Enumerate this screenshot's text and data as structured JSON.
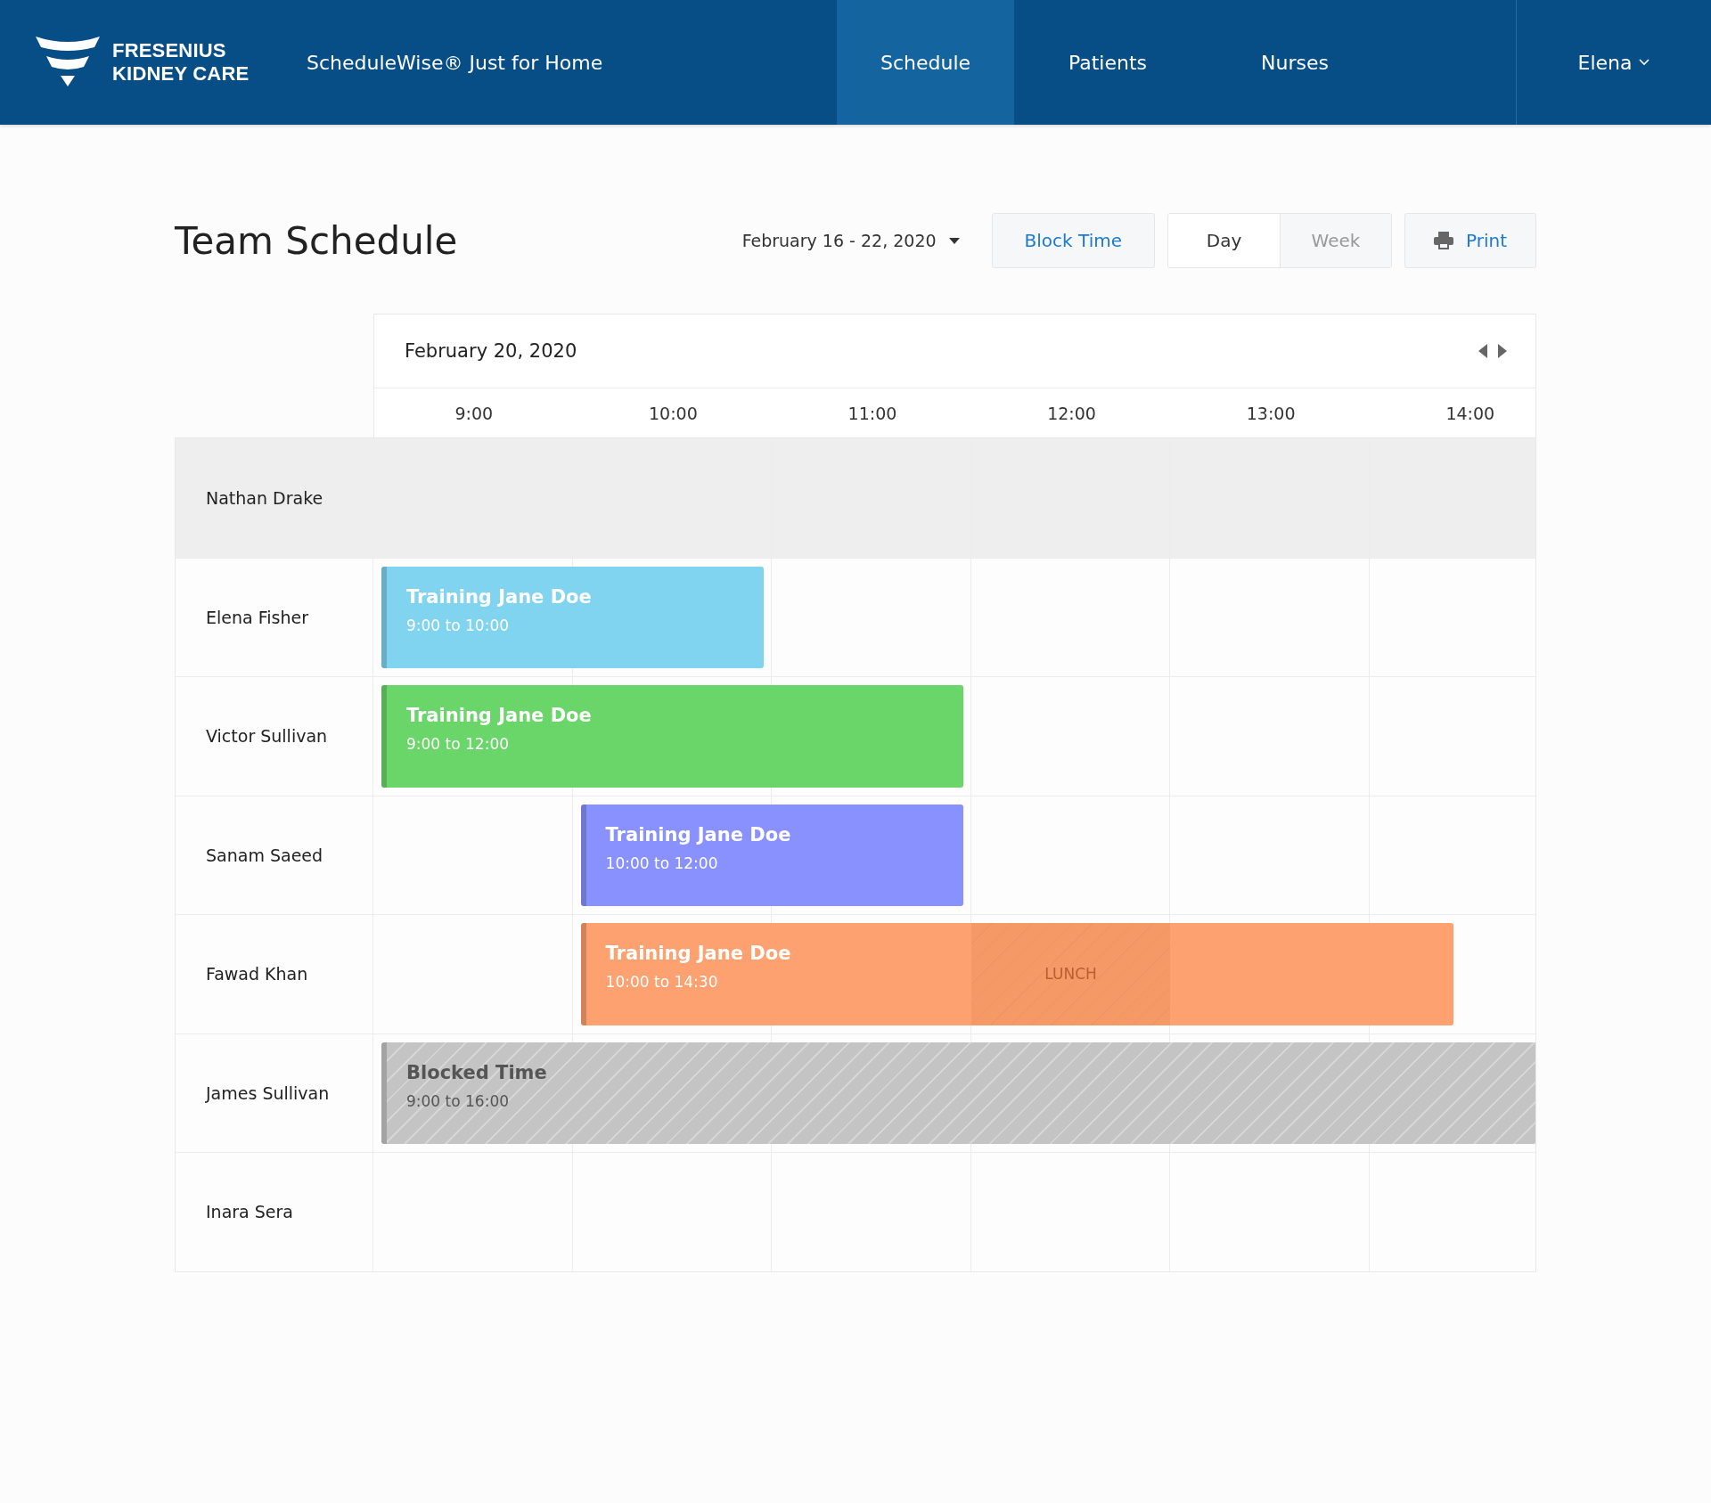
{
  "header": {
    "logo": {
      "line1": "FRESENIUS",
      "line2": "KIDNEY CARE"
    },
    "app_name": "ScheduleWise® Just for Home",
    "nav": [
      {
        "label": "Schedule",
        "selected": true
      },
      {
        "label": "Patients",
        "selected": false
      },
      {
        "label": "Nurses",
        "selected": false
      }
    ],
    "user": {
      "name": "Elena"
    }
  },
  "toolbar": {
    "title": "Team Schedule",
    "date_range": "February 16 - 22, 2020",
    "block_button": "Block Time",
    "views": [
      {
        "label": "Day",
        "selected": true
      },
      {
        "label": "Week",
        "selected": false
      }
    ],
    "print_button": "Print"
  },
  "calendar": {
    "date": "February 20, 2020",
    "hours": [
      "9:00",
      "10:00",
      "11:00",
      "12:00",
      "13:00",
      "14:00"
    ],
    "rows": [
      {
        "name": "Nathan Drake",
        "selected": true
      },
      {
        "name": "Elena Fisher",
        "selected": false,
        "events": [
          {
            "kind": "training",
            "title": "Training Jane Doe",
            "time": "9:00 to 10:00",
            "color": "#81d4f0"
          }
        ]
      },
      {
        "name": "Victor Sullivan",
        "selected": false,
        "events": [
          {
            "kind": "training",
            "title": "Training Jane Doe",
            "time": "9:00 to 12:00",
            "color": "#6ad66a"
          }
        ]
      },
      {
        "name": "Sanam Saeed",
        "selected": false,
        "events": [
          {
            "kind": "training",
            "title": "Training Jane Doe",
            "time": "10:00 to 12:00",
            "color": "#8891fd"
          }
        ]
      },
      {
        "name": "Fawad Khan",
        "selected": false,
        "events": [
          {
            "kind": "training",
            "title": "Training Jane Doe",
            "time": "10:00 to 14:30",
            "color": "#fca16f",
            "break": {
              "label": "LUNCH"
            }
          }
        ]
      },
      {
        "name": "James Sullivan",
        "selected": false,
        "events": [
          {
            "kind": "blocked",
            "title": "Blocked Time",
            "time": "9:00 to 16:00"
          }
        ]
      },
      {
        "name": "Inara Sera",
        "selected": false
      }
    ]
  }
}
